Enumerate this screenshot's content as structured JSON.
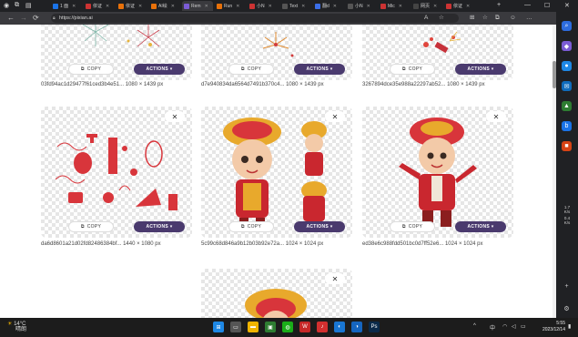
{
  "tabs": [
    {
      "label": "1 面",
      "color": "#1a73e8",
      "active": false
    },
    {
      "label": "依证",
      "color": "#cc3333",
      "active": false
    },
    {
      "label": "依证",
      "color": "#e8710a",
      "active": false
    },
    {
      "label": "AI绘",
      "color": "#e8710a",
      "active": false
    },
    {
      "label": "Rem",
      "color": "#7b5cd6",
      "active": true
    },
    {
      "label": "Run",
      "color": "#e8710a",
      "active": false
    },
    {
      "label": "小N",
      "color": "#cc3333",
      "active": false
    },
    {
      "label": "Text",
      "color": "#555555",
      "active": false
    },
    {
      "label": "翻d",
      "color": "#3b6ee8",
      "active": false
    },
    {
      "label": "小N",
      "color": "#555555",
      "active": false
    },
    {
      "label": "Mic",
      "color": "#cc3333",
      "active": false
    },
    {
      "label": "网页",
      "color": "#444444",
      "active": false
    },
    {
      "label": "依证",
      "color": "#cc3333",
      "active": false
    }
  ],
  "browser": {
    "url": "https://pixian.ai",
    "back": "←",
    "forward": "→",
    "reload": "⟳",
    "home": "⌂",
    "new_tab": "+",
    "minimize": "—",
    "maximize": "☐",
    "close": "✕",
    "tools": [
      "A",
      "☆",
      "⊞",
      "☆",
      "⧉",
      "☺",
      "…"
    ]
  },
  "cards": [
    {
      "copy_label": "COPY",
      "actions_label": "ACTIONS ▾",
      "caption": "03fd94ac1d29477f61ced3b4e51... 1080 × 1439 px",
      "has_close": false,
      "image_icon": "fireworks-image"
    },
    {
      "copy_label": "COPY",
      "actions_label": "ACTIONS ▾",
      "caption": "d7e940834da6564d7491b370c4... 1080 × 1439 px",
      "has_close": false,
      "image_icon": "fireworks-image"
    },
    {
      "copy_label": "COPY",
      "actions_label": "ACTIONS ▾",
      "caption": "3267894dce35e988a22297ab52... 1080 × 1439 px",
      "has_close": false,
      "image_icon": "firecracker-image"
    },
    {
      "copy_label": "COPY",
      "actions_label": "ACTIONS ▾",
      "caption": "da6d8601a21d02fd82486384bf... 1440 × 1080 px",
      "has_close": true,
      "close_label": "✕",
      "image_icon": "chinese-decorations-image"
    },
    {
      "copy_label": "COPY",
      "actions_label": "ACTIONS ▾",
      "caption": "5c99c68d846a9b12b03b92e72a... 1024 × 1024 px",
      "has_close": true,
      "close_label": "✕",
      "image_icon": "dragon-hat-kids-image"
    },
    {
      "copy_label": "COPY",
      "actions_label": "ACTIONS ▾",
      "caption": "ed38e6c988fdd501bc0d7ff52e6... 1024 × 1024 px",
      "has_close": true,
      "close_label": "✕",
      "image_icon": "dragon-hat-boy-image"
    },
    {
      "caption": "",
      "has_close": true,
      "close_label": "✕",
      "image_icon": "dragon-hat-partial-image"
    }
  ],
  "sidebar": {
    "items": [
      {
        "icon": "search-icon",
        "glyph": "⌕",
        "color": "#2d6cdf"
      },
      {
        "icon": "extension-icon",
        "glyph": "◆",
        "color": "#7b5cd6"
      },
      {
        "icon": "edge-icon",
        "glyph": "●",
        "color": "#1e88e5"
      },
      {
        "icon": "outlook-icon",
        "glyph": "✉",
        "color": "#0f6cbd"
      },
      {
        "icon": "games-icon",
        "glyph": "▲",
        "color": "#2e7d32"
      },
      {
        "icon": "bing-icon",
        "glyph": "b",
        "color": "#1a73e8"
      },
      {
        "icon": "office-icon",
        "glyph": "■",
        "color": "#d84315"
      }
    ],
    "stats": [
      {
        "label": "1.7",
        "sub": "K/s"
      },
      {
        "label": "0.4",
        "sub": "K/s"
      }
    ],
    "add": "+",
    "settings": "⚙"
  },
  "taskbar": {
    "weather_temp": "14°C",
    "weather_desc": "晴朗",
    "tray_lang": "中",
    "time": "5:55",
    "date": "2023/12/14",
    "apps": [
      {
        "icon": "start-icon",
        "color": "#1e88e5",
        "glyph": "⊞"
      },
      {
        "icon": "task-view-icon",
        "color": "#555555",
        "glyph": "▭"
      },
      {
        "icon": "file-explorer-icon",
        "color": "#f0b400",
        "glyph": "▬"
      },
      {
        "icon": "photos-icon",
        "color": "#2e7d32",
        "glyph": "▣"
      },
      {
        "icon": "wechat-icon",
        "color": "#1aad19",
        "glyph": "◍"
      },
      {
        "icon": "wps-icon",
        "color": "#c62828",
        "glyph": "W"
      },
      {
        "icon": "netease-music-icon",
        "color": "#d32f2f",
        "glyph": "♪"
      },
      {
        "icon": "edge-browser-icon",
        "color": "#1976d2",
        "glyph": "◐"
      },
      {
        "icon": "edge-dev-icon",
        "color": "#1565c0",
        "glyph": "◑"
      },
      {
        "icon": "photoshop-icon",
        "color": "#0b2a4a",
        "glyph": "Ps"
      }
    ]
  }
}
